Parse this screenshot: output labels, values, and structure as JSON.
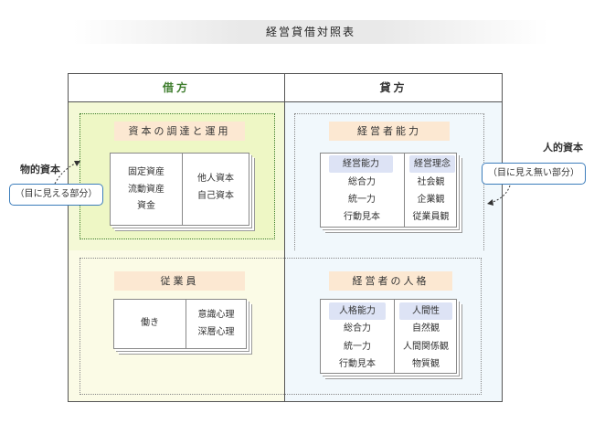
{
  "title": "経営貸借対照表",
  "header": {
    "debit": "借方",
    "credit": "貸方"
  },
  "quadrants": {
    "top_left": {
      "heading": "資本の調達と運用",
      "left_items": [
        "固定資産",
        "流動資産",
        "資金"
      ],
      "right_items": [
        "他人資本",
        "自己資本"
      ]
    },
    "top_right": {
      "heading": "経営者能力",
      "left_header": "経営能力",
      "left_items": [
        "総合力",
        "統一力",
        "行動見本"
      ],
      "right_header": "経営理念",
      "right_items": [
        "社会観",
        "企業観",
        "従業員観"
      ]
    },
    "bottom_left": {
      "heading": "従業員",
      "left_items": [
        "働き"
      ],
      "right_items": [
        "意識心理",
        "深層心理"
      ]
    },
    "bottom_right": {
      "heading": "経営者の人格",
      "left_header": "人格能力",
      "left_items": [
        "総合力",
        "統一力",
        "行動見本"
      ],
      "right_header": "人間性",
      "right_items": [
        "自然観",
        "人間関係観",
        "物質観"
      ]
    }
  },
  "annotations": {
    "physical_capital": {
      "label": "物的資本",
      "note": "（目に見える部分）"
    },
    "human_capital": {
      "label": "人的資本",
      "note": "（目に見え無い部分）"
    }
  }
}
